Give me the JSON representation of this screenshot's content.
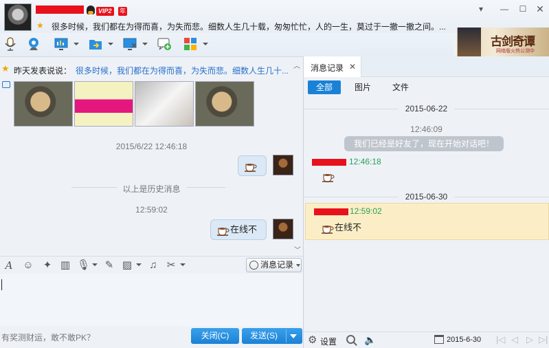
{
  "header": {
    "vip_badge": "VIP2",
    "year_badge": "年",
    "signature": "很多时候，我们都在为得而喜，为失而悲。细数人生几十载，匆匆忙忙，人的一生，莫过于一撤一撤之间。..."
  },
  "ad": {
    "title": "古剑奇谭",
    "subtitle": "网络版火热公测中"
  },
  "chat": {
    "status_label": "昨天发表说说：",
    "status_text": "很多时候，我们都在为得而喜，为失而悲。细数人生几十...",
    "timestamp1": "2015/6/22 12:46:18",
    "history_divider": "以上是历史消息",
    "timestamp2": "12:59:02",
    "message2_text": "在线不"
  },
  "input": {
    "message_record_label": "消息记录",
    "ad_link": "有奖测财运，敢不敢PK？",
    "close_label": "关闭(C)",
    "send_label": "发送(S)"
  },
  "history": {
    "tab_title": "消息记录",
    "filter_all": "全部",
    "filter_pictures": "图片",
    "filter_files": "文件",
    "date1": "2015-06-22",
    "time1": "12:46:09",
    "system_message": "我们已经是好友了，现在开始对话吧！",
    "msg1_time": "12:46:18",
    "date2": "2015-06-30",
    "msg2_time": "12:59:02",
    "msg2_text": "在线不",
    "settings_label": "设置",
    "date_field": "2015-6-30"
  },
  "colors": {
    "accent": "#1a82d6",
    "link": "#2a6fc9",
    "redaction": "#e8121c",
    "time_green": "#2aa055",
    "highlight_bg": "#fbeec7"
  }
}
